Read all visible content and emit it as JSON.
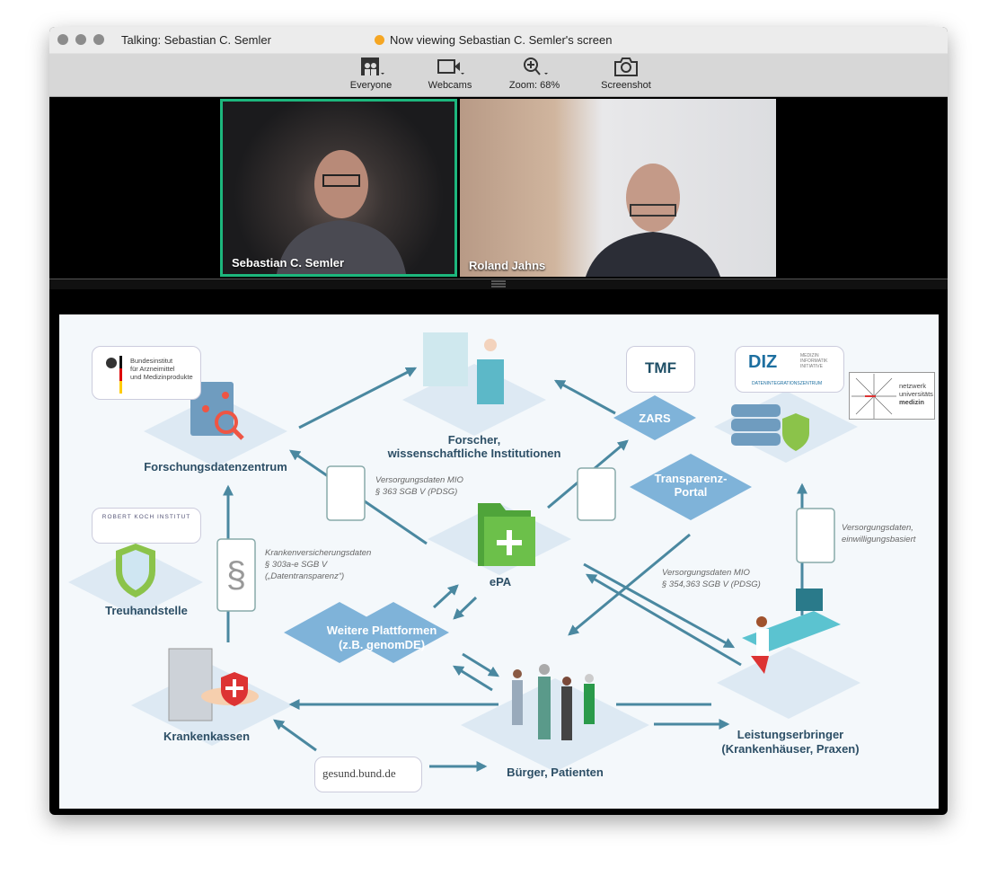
{
  "window": {
    "talking": "Talking: Sebastian C. Semler",
    "viewing": "Now viewing Sebastian C. Semler's screen"
  },
  "toolbar": {
    "everyone": "Everyone",
    "webcams": "Webcams",
    "zoom": "Zoom: 68%",
    "screenshot": "Screenshot"
  },
  "videos": [
    {
      "name": "Sebastian C. Semler",
      "active": true
    },
    {
      "name": "Roland Jahns",
      "active": false
    }
  ],
  "colors": {
    "active_border": "#1db77d",
    "arrow": "#4a88a0",
    "label": "#2d4f66",
    "tile": "#7fb3d9"
  },
  "slide": {
    "fdz": "Forschungsdatenzentrum",
    "forscher1": "Forscher,",
    "forscher2": "wissenschaftliche Institutionen",
    "zars": "ZARS",
    "tp1": "Transparenz-",
    "tp2": "Portal",
    "epa": "ePA",
    "treuhand": "Treuhandstelle",
    "weitere1": "Weitere Plattformen",
    "weitere2": "(z.B. genomDE)",
    "kassen": "Krankenkassen",
    "buerger": "Bürger, Patienten",
    "le1": "Leistungserbringer",
    "le2": "(Krankenhäuser, Praxen)",
    "n1a": "Versorgungsdaten MIO",
    "n1b": "§ 363 SGB V (PDSG)",
    "n2a": "Krankenversicherungsdaten",
    "n2b": "§ 303a-e SGB V",
    "n2c": "(„Datentransparenz“)",
    "n3a": "Versorgungsdaten MIO",
    "n3b": "§ 354,363 SGB V (PDSG)",
    "n4a": "Versorgungsdaten,",
    "n4b": "einwilligungsbasiert",
    "logos": {
      "bfarm": [
        "Bundesinstitut",
        "für Arzneimittel",
        "und Medizinprodukte"
      ],
      "rki": "ROBERT KOCH INSTITUT",
      "tmf": "TMF",
      "diz": "DIZ",
      "diz_sub": "DATENINTEGRATIONSZENTRUM",
      "mii": [
        "MEDIZIN",
        "INFORMATIK",
        "INITIATIVE"
      ],
      "num": [
        "netzwerk",
        "universitäts",
        "medizin"
      ],
      "gesund": "gesund.bund.de"
    }
  }
}
